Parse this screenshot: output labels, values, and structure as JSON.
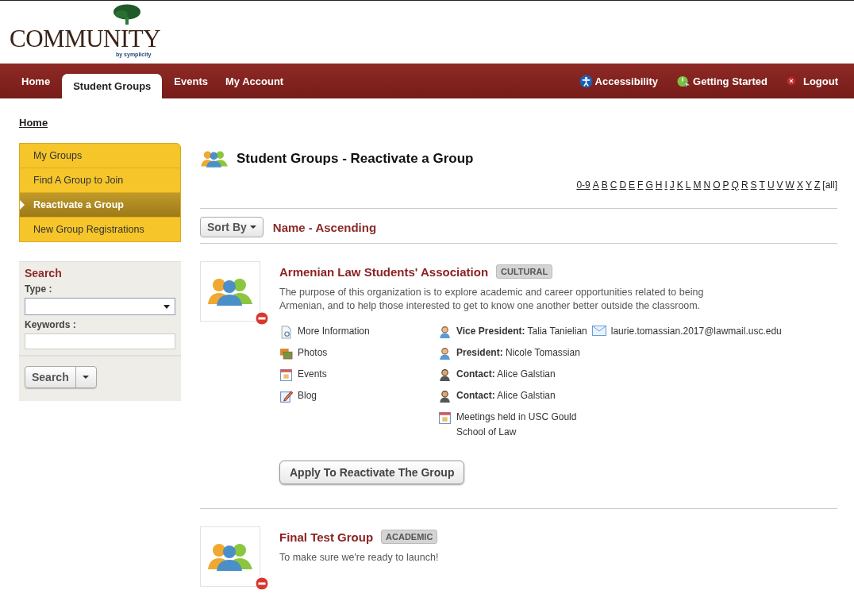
{
  "logo": {
    "wordmark": "COMMUNITY",
    "byline": "by symplicity"
  },
  "nav": {
    "tabs": [
      {
        "label": "Home",
        "selected": false
      },
      {
        "label": "Student Groups",
        "selected": true
      },
      {
        "label": "Events",
        "selected": false
      },
      {
        "label": "My Account",
        "selected": false
      }
    ],
    "links": [
      {
        "label": "Accessibility",
        "kind": "accessibility"
      },
      {
        "label": "Getting Started",
        "kind": "start"
      },
      {
        "label": "Logout",
        "kind": "logout"
      }
    ]
  },
  "breadcrumb": "Home",
  "side_menu": [
    {
      "label": "My Groups",
      "selected": false
    },
    {
      "label": "Find A Group to Join",
      "selected": false
    },
    {
      "label": "Reactivate a Group",
      "selected": true
    },
    {
      "label": "New Group Registrations",
      "selected": false
    }
  ],
  "search": {
    "title": "Search",
    "type_label": "Type :",
    "keywords_label": "Keywords :",
    "button": "Search"
  },
  "page_title": "Student Groups - Reactivate a Group",
  "letters": [
    "0-9",
    "A",
    "B",
    "C",
    "D",
    "E",
    "F",
    "G",
    "H",
    "I",
    "J",
    "K",
    "L",
    "M",
    "N",
    "O",
    "P",
    "Q",
    "R",
    "S",
    "T",
    "U",
    "V",
    "W",
    "X",
    "Y",
    "Z"
  ],
  "all_link": "[all]",
  "sort": {
    "button": "Sort By",
    "value": "Name - Ascending"
  },
  "groups": [
    {
      "name": "Armenian Law Students' Association",
      "tag": "CULTURAL",
      "description": "The purpose of this organization is to explore academic and career opportunities related to being Armenian, and to help those interested to get to know one another better outside the classroom.",
      "links": [
        {
          "label": "More Information",
          "kind": "info"
        },
        {
          "label": "Photos",
          "kind": "photos"
        },
        {
          "label": "Events",
          "kind": "events"
        },
        {
          "label": "Blog",
          "kind": "blog"
        }
      ],
      "contacts": [
        {
          "kind": "officer",
          "role": "Vice President:",
          "name": "Talia Tanielian",
          "email": "laurie.tomassian.2017@lawmail.usc.edu"
        },
        {
          "kind": "officer",
          "role": "President:",
          "name": "Nicole Tomassian"
        },
        {
          "kind": "contact",
          "role": "Contact:",
          "name": "Alice Galstian"
        },
        {
          "kind": "contact",
          "role": "Contact:",
          "name": "Alice Galstian"
        }
      ],
      "meeting": "Meetings held in USC Gould School of Law",
      "button": "Apply To Reactivate The Group"
    },
    {
      "name": "Final Test Group",
      "tag": "ACADEMIC",
      "description": "To make sure we're ready to launch!"
    }
  ]
}
